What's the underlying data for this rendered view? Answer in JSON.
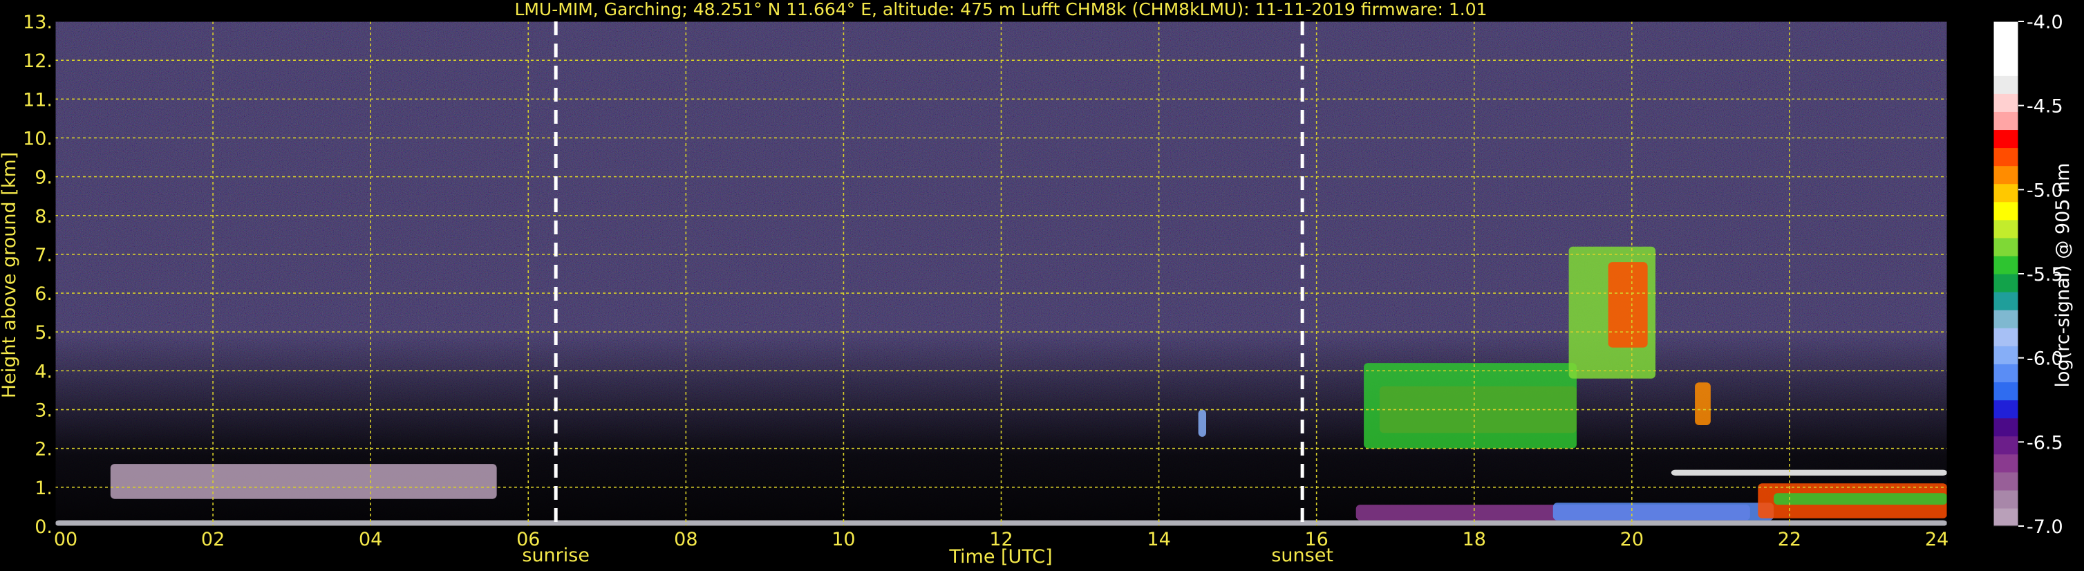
{
  "title": "LMU-MIM, Garching; 48.251° N 11.664° E, altitude: 475 m    Lufft CHM8k (CHM8kLMU): 11-11-2019    firmware: 1.01",
  "colors": {
    "background": "#000000",
    "text": "#f5e94a",
    "grid": "#d8cf2a",
    "colorbar_label": "#ffffff",
    "event_line": "#ffffff"
  },
  "chart_data": {
    "type": "heatmap",
    "title": "LMU-MIM, Garching; 48.251° N 11.664° E, altitude: 475 m    Lufft CHM8k (CHM8kLMU): 11-11-2019    firmware: 1.01",
    "xlabel": "Time [UTC]",
    "ylabel": "Height above ground [km]",
    "xlim": [
      0,
      24
    ],
    "ylim": [
      0,
      13
    ],
    "x_ticks": [
      0,
      2,
      4,
      6,
      8,
      10,
      12,
      14,
      16,
      18,
      20,
      22,
      24
    ],
    "x_tick_labels": [
      "00",
      "02",
      "04",
      "06",
      "08",
      "10",
      "12",
      "14",
      "16",
      "18",
      "20",
      "22",
      "24"
    ],
    "y_ticks": [
      0,
      1,
      2,
      3,
      4,
      5,
      6,
      7,
      8,
      9,
      10,
      11,
      12,
      13
    ],
    "y_tick_labels": [
      "0.",
      "1.",
      "2.",
      "3.",
      "4.",
      "5.",
      "6.",
      "7.",
      "8.",
      "9.",
      "10.",
      "11.",
      "12.",
      "13."
    ],
    "grid": true,
    "events": [
      {
        "label": "sunrise",
        "time": 6.35
      },
      {
        "label": "sunset",
        "time": 15.82
      }
    ],
    "colorbar": {
      "label": "log(rc-signal) @ 905 nm",
      "range": [
        -7.0,
        -4.0
      ],
      "ticks": [
        -4.0,
        -4.5,
        -5.0,
        -5.5,
        -6.0,
        -6.5,
        -7.0
      ],
      "tick_labels": [
        "-4.0",
        "-4.5",
        "-5.0",
        "-5.5",
        "-6.0",
        "-6.5",
        "-7.0"
      ],
      "colors": [
        "#b9a0b9",
        "#a887a9",
        "#985f98",
        "#8a3a8f",
        "#6c1e8a",
        "#4b0a88",
        "#2020d8",
        "#2f6cf0",
        "#5a8df5",
        "#86aef7",
        "#a7c0f5",
        "#7fb8d0",
        "#1f9e9a",
        "#12a24a",
        "#2ec430",
        "#7fd836",
        "#c3ec2c",
        "#ffff00",
        "#ffc800",
        "#ff8c00",
        "#ff4d00",
        "#ff0000",
        "#ffa5a5",
        "#ffd0d0",
        "#ebebeb",
        "#ffffff",
        "#ffffff",
        "#ffffff"
      ]
    }
  }
}
